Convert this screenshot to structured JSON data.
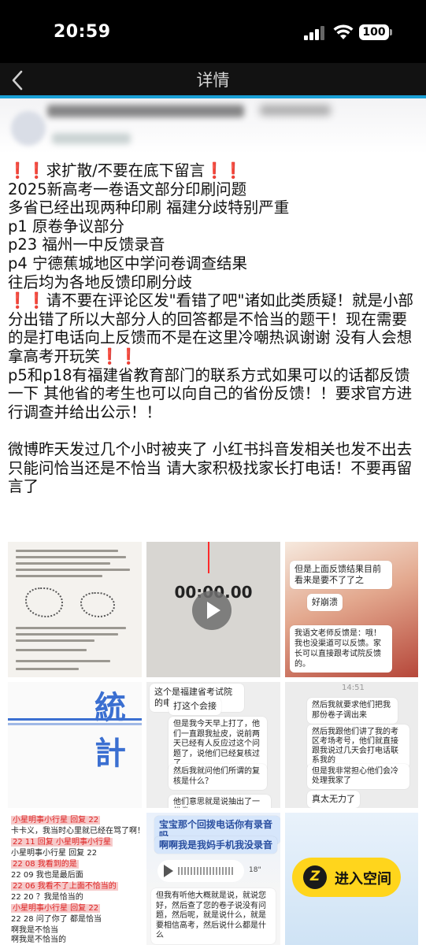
{
  "status_bar": {
    "time": "20:59",
    "battery": "100"
  },
  "nav": {
    "title": "详情"
  },
  "post": {
    "lines": [
      "求扩散/不要在底下留言",
      "2025新高考一卷语文部分印刷问题",
      "多省已经出现两种印刷 福建分歧特别严重",
      "p1 原卷争议部分",
      "p23 福州一中反馈录音",
      "p4 宁德蕉城地区中学问卷调查结果",
      "往后均为各地反馈印刷分歧",
      "请不要在评论区发\"看错了吧\"诸如此类质疑！就是小部分出错了所以大部分人的回答都是不恰当的题干！现在需要的是打电话向上反馈而不是在这里冷嘲热讽谢谢 没有人会想拿高考开玩笑",
      "p5和p18有福建省教育部门的联系方式如果可以的话都反馈一下 其他省的考生也可以向自己的省份反馈！！要求官方进行调查并给出公示！！",
      "微博昨天发过几个小时被夹了 小红书抖音发相关也发不出去只能问恰当还是不恰当 请大家积极找家长打电话！不要再留言了"
    ]
  },
  "images": {
    "audio_time": "00:00.00",
    "chat_top": {
      "bubble1": "但是上面反馈结果目前看来是要不了了之",
      "bubble2": "好崩溃",
      "bubble3": "我语文老师反馈是：哦！我也没渠道可以反馈。家长可以直接跟考试院反馈的。"
    },
    "survey_title": "統計",
    "chat_mid": {
      "bubble1": "这个是福建省考试院的电话",
      "bubble2": "打这个会接",
      "bubble3": "但是我今天早上打了，他们一直跟我扯皮，说前两天已经有人反应过这个问题了，说他们已经复核过了",
      "bubble4": "然后我就问他们所谓的复核是什么？",
      "bubble5": "他们意思就是说抽出了一份卷"
    },
    "chat_right": {
      "timestamp": "14:51",
      "bubble1": "然后我就要求他们把我那份卷子调出来",
      "bubble2": "然后我跟他们讲了我的考区考场考号，他们就直接跟我说过几天会打电话联系我的",
      "bubble3": "但是我非常担心他们会冷处理我家了",
      "bubble4": "真太无力了"
    },
    "group_chat": {
      "lines": [
        "小星明事小行星 回复 22",
        "卡卡义，我当时心里就已经在骂了啊！",
        "22 11 回复 小星明事小行星",
        "小星明事小行星 回复 22",
        "22 08 我看到的是",
        "22 09 我也是最后面",
        "22 06 我看不了上面不恰当的",
        "22 20 ？我是恰当的",
        "小星明事小行星 回复 22",
        "22 28 问了你了 都是恰当",
        "啊我是不恰当",
        "啊我是不恰当的"
      ]
    },
    "voice_chat": {
      "title": "宝宝那个回拨电话你有录音吗",
      "reply": "啊啊我是我妈手机我没录音",
      "duration": "18\"",
      "text": "但我有听他大概就是说，就说您好，然后查了您的卷子说没有问题，然后呢，就是说什么，就是要相信高考，然后说什么都是什么"
    }
  },
  "enter_space": {
    "label": "进入空间"
  },
  "colors": {
    "accent": "#1aa0d6",
    "exclaim": "#e0202a",
    "button": "#ffd51c"
  }
}
